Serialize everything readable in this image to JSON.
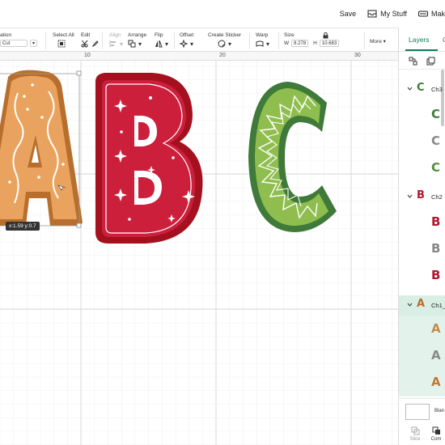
{
  "topbar": {
    "save_label": "Save",
    "mystuff_label": "My Stuff",
    "make_label": "Mak"
  },
  "toolbar": {
    "operation_label": "ation",
    "operation_value": "Cut",
    "selectall_label": "Select All",
    "edit_label": "Edit",
    "align_label": "Align",
    "arrange_label": "Arrange",
    "flip_label": "Flip",
    "offset_label": "Offset",
    "createsticker_label": "Create Sticker",
    "warp_label": "Warp",
    "size_label": "Size",
    "w_label": "W",
    "w_value": "8.278",
    "h_label": "H",
    "h_value": "10.683",
    "more_label": "More"
  },
  "ruler": {
    "marks": [
      "10",
      "20",
      "30"
    ]
  },
  "canvas": {
    "coord_readout": "x:1.59 y:0.7"
  },
  "panel": {
    "tab_layers": "Layers",
    "tab_color": "C",
    "groups": [
      {
        "name": "Ch3",
        "letter": "C",
        "color": "#3f7a3a"
      },
      {
        "name": "Ch2",
        "letter": "B",
        "color": "#b1162f"
      },
      {
        "name": "Ch1_",
        "letter": "A",
        "color": "#b86e2c"
      }
    ],
    "layers": [
      {
        "letter": "C",
        "color": "#3f7a3a"
      },
      {
        "letter": "C",
        "color": "#888888"
      },
      {
        "letter": "C",
        "color": "#4f8f3a"
      },
      {
        "letter": "B",
        "color": "#b1162f"
      },
      {
        "letter": "B",
        "color": "#888888"
      },
      {
        "letter": "B",
        "color": "#b1162f"
      },
      {
        "letter": "A",
        "color": "#c48a4b"
      },
      {
        "letter": "A",
        "color": "#888888"
      },
      {
        "letter": "A",
        "color": "#c07a32"
      }
    ],
    "blank_label": "Blan",
    "bottom_buttons": [
      "Slice",
      "Com"
    ]
  },
  "colors": {
    "accent": "#147a5e",
    "letter_a_fill": "#e9a35f",
    "letter_a_outline": "#b86e2c",
    "letter_b_fill": "#cc1f3c",
    "letter_b_outline": "#a5101f",
    "letter_c_fill": "#8fbe4f",
    "letter_c_outline": "#3f7a3a"
  }
}
